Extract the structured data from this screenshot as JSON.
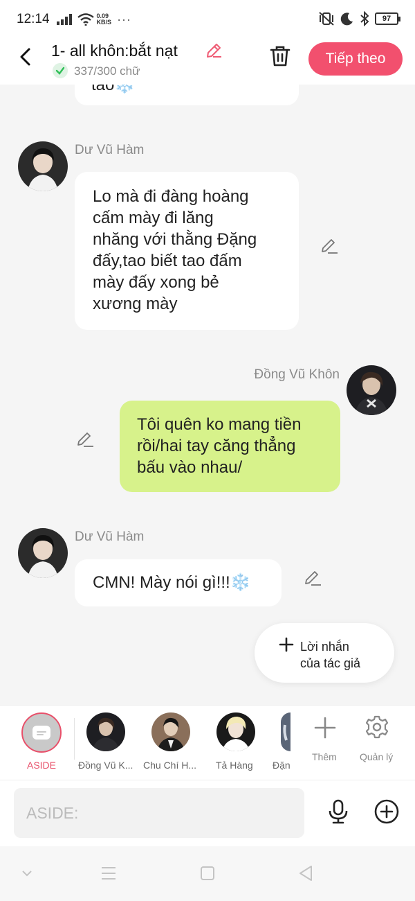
{
  "status_bar": {
    "time": "12:14",
    "net_speed_value": "0.09",
    "net_speed_unit": "KB/S",
    "overflow": "···",
    "battery": "97"
  },
  "header": {
    "title": "1- all khôn:bắt nạt",
    "word_count": "337/300 chữ",
    "next_label": "Tiếp theo"
  },
  "chat": {
    "partial_top": "tao❄️",
    "messages": [
      {
        "sender": "Dư Vũ Hàm",
        "side": "left",
        "lines": [
          "Lo mà đi đàng hoàng",
          "cấm mày đi lăng",
          "nhăng với thằng Đặng",
          "đấy,tao biết tao đấm",
          "mày đấy xong bẻ",
          "xương mày"
        ]
      },
      {
        "sender": "Đồng Vũ Khôn",
        "side": "right",
        "lines": [
          "Tôi quên ko mang tiền",
          "rồi/hai tay căng thẳng",
          "bấu vào nhau/"
        ]
      },
      {
        "sender": "Dư Vũ Hàm",
        "side": "left",
        "lines": [
          "CMN! Mày nói gì!!!❄️"
        ]
      }
    ],
    "author_note": {
      "line1": "Lời nhắn",
      "line2": "của tác giả"
    }
  },
  "character_bar": {
    "aside_label": "ASIDE",
    "characters": [
      "Đồng Vũ K...",
      "Chu Chí H...",
      "Tả Hàng",
      "Đặn"
    ],
    "add_label": "Thêm",
    "manage_label": "Quản lý"
  },
  "input": {
    "placeholder": "ASIDE:"
  },
  "colors": {
    "accent": "#f2506e",
    "bubble_right": "#d7f28b",
    "bubble_left": "#ffffff",
    "background": "#f5f5f5"
  },
  "icons": [
    "back-icon",
    "edit-icon",
    "check-icon",
    "trash-icon",
    "pencil-icon",
    "plus-icon",
    "gear-icon",
    "mic-icon",
    "plus-circle-icon",
    "nav-down-icon",
    "nav-menu-icon",
    "nav-home-icon",
    "nav-back-icon"
  ]
}
